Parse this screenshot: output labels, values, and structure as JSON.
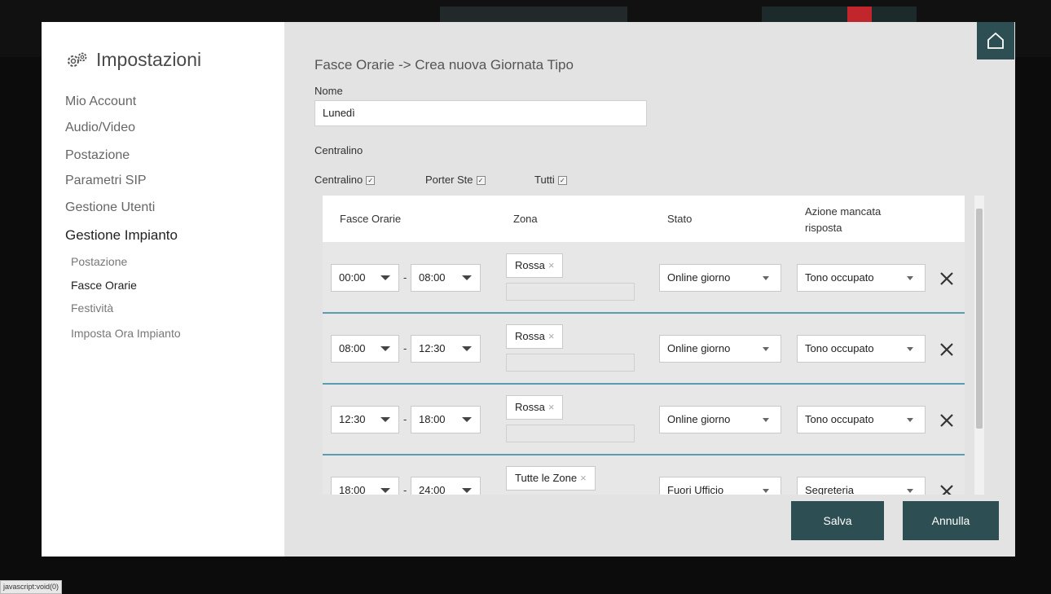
{
  "sidebar": {
    "title": "Impostazioni",
    "items": [
      {
        "label": "Mio Account"
      },
      {
        "label": "Audio/Video"
      },
      {
        "label": "Postazione"
      },
      {
        "label": "Parametri SIP"
      },
      {
        "label": "Gestione Utenti"
      },
      {
        "label": "Gestione Impianto"
      }
    ],
    "subitems": [
      {
        "label": "Postazione"
      },
      {
        "label": "Fasce Orarie"
      },
      {
        "label": "Festività"
      },
      {
        "label": "Imposta Ora Impianto"
      }
    ]
  },
  "main": {
    "title": "Fasce Orarie -> Crea nuova Giornata Tipo",
    "name_label": "Nome",
    "name_value": "Lunedì",
    "centralino_label": "Centralino",
    "checkboxes": [
      {
        "label": "Centralino",
        "checked": true
      },
      {
        "label": "Porter Ste",
        "checked": true
      },
      {
        "label": "Tutti",
        "checked": true
      }
    ]
  },
  "table": {
    "headers": {
      "fasce": "Fasce Orarie",
      "zona": "Zona",
      "stato": "Stato",
      "azione_line1": "Azione mancata",
      "azione_line2": "risposta"
    },
    "rows": [
      {
        "start": "00:00",
        "end": "08:00",
        "zona": "Rossa",
        "stato": "Online giorno",
        "azione": "Tono occupato"
      },
      {
        "start": "08:00",
        "end": "12:30",
        "zona": "Rossa",
        "stato": "Online giorno",
        "azione": "Tono occupato"
      },
      {
        "start": "12:30",
        "end": "18:00",
        "zona": "Rossa",
        "stato": "Online giorno",
        "azione": "Tono occupato"
      },
      {
        "start": "18:00",
        "end": "24:00",
        "zona": "Tutte le Zone",
        "stato": "Fuori Ufficio",
        "azione": "Segreteria"
      }
    ],
    "dash": "-",
    "tag_remove": "×"
  },
  "buttons": {
    "save": "Salva",
    "cancel": "Annulla"
  },
  "statusbar": "javascript:void(0)",
  "colors": {
    "accent": "#2d4f53",
    "row_divider": "#5a9db3"
  }
}
